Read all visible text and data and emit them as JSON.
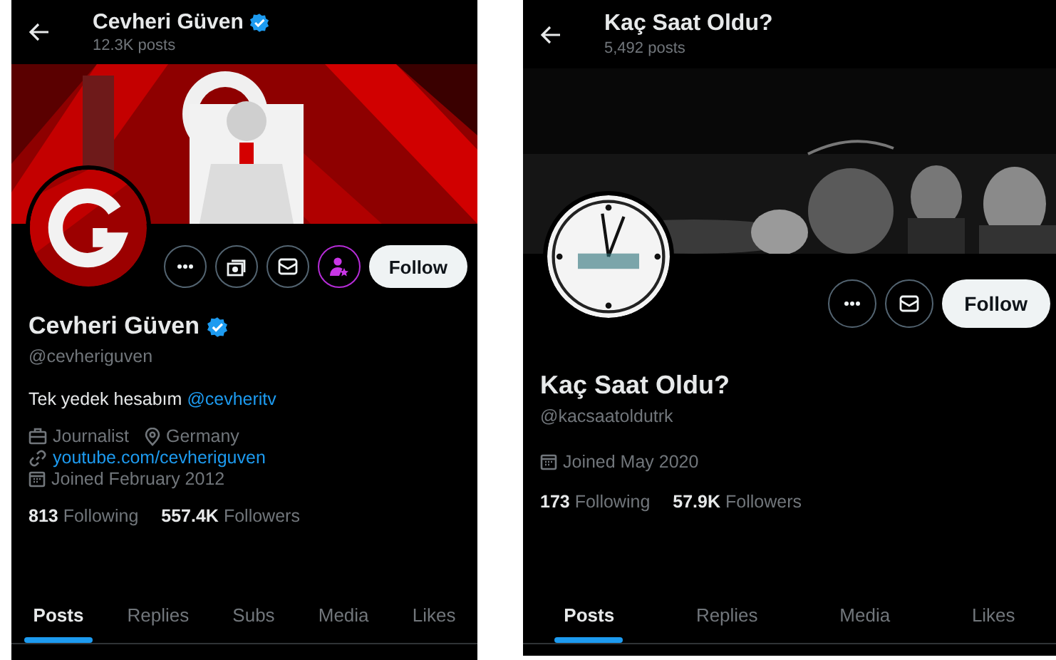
{
  "profiles": [
    {
      "title": "Cevheri Güven",
      "posts": "12.3K posts",
      "verified": true,
      "banner": {
        "kind": "picture"
      },
      "avatar": {
        "kind": "picture"
      },
      "actions": [
        {
          "kind": "more"
        },
        {
          "kind": "subscribe"
        },
        {
          "kind": "message"
        },
        {
          "kind": "member"
        },
        {
          "kind": "follow",
          "label": "Follow"
        }
      ],
      "name": "Cevheri Güven",
      "handle": "@cevheriguven",
      "bio": {
        "text": "Tek yedek hesabım",
        "link": "@cevheritv"
      },
      "meta": [
        [
          {
            "kind": "job",
            "text": "Journalist"
          },
          {
            "kind": "location",
            "text": "Germany"
          }
        ],
        [
          {
            "kind": "link",
            "text": "youtube.com/cevheriguven"
          }
        ],
        [
          {
            "kind": "joined",
            "text": "Joined February 2012"
          }
        ]
      ],
      "stats": [
        {
          "count": "813",
          "label": "Following"
        },
        {
          "count": "557.4K",
          "label": "Followers"
        }
      ],
      "tabs": [
        {
          "label": "Posts",
          "selected": true
        },
        {
          "label": "Replies",
          "selected": false
        },
        {
          "label": "Subs",
          "selected": false
        },
        {
          "label": "Media",
          "selected": false
        },
        {
          "label": "Likes",
          "selected": false
        }
      ]
    },
    {
      "title": "Kaç Saat Oldu?",
      "posts": "5,492 posts",
      "verified": false,
      "banner": {
        "kind": "picture"
      },
      "avatar": {
        "kind": "picture"
      },
      "actions": [
        {
          "kind": "more"
        },
        {
          "kind": "message"
        },
        {
          "kind": "follow",
          "label": "Follow"
        }
      ],
      "name": "Kaç Saat Oldu?",
      "handle": "@kacsaatoldutrk",
      "meta": [
        [
          {
            "kind": "joined",
            "text": "Joined May 2020"
          }
        ]
      ],
      "stats": [
        {
          "count": "173",
          "label": "Following"
        },
        {
          "count": "57.9K",
          "label": "Followers"
        }
      ],
      "tabs": [
        {
          "label": "Posts",
          "selected": true
        },
        {
          "label": "Replies",
          "selected": false
        },
        {
          "label": "Media",
          "selected": false
        },
        {
          "label": "Likes",
          "selected": false
        }
      ]
    }
  ]
}
